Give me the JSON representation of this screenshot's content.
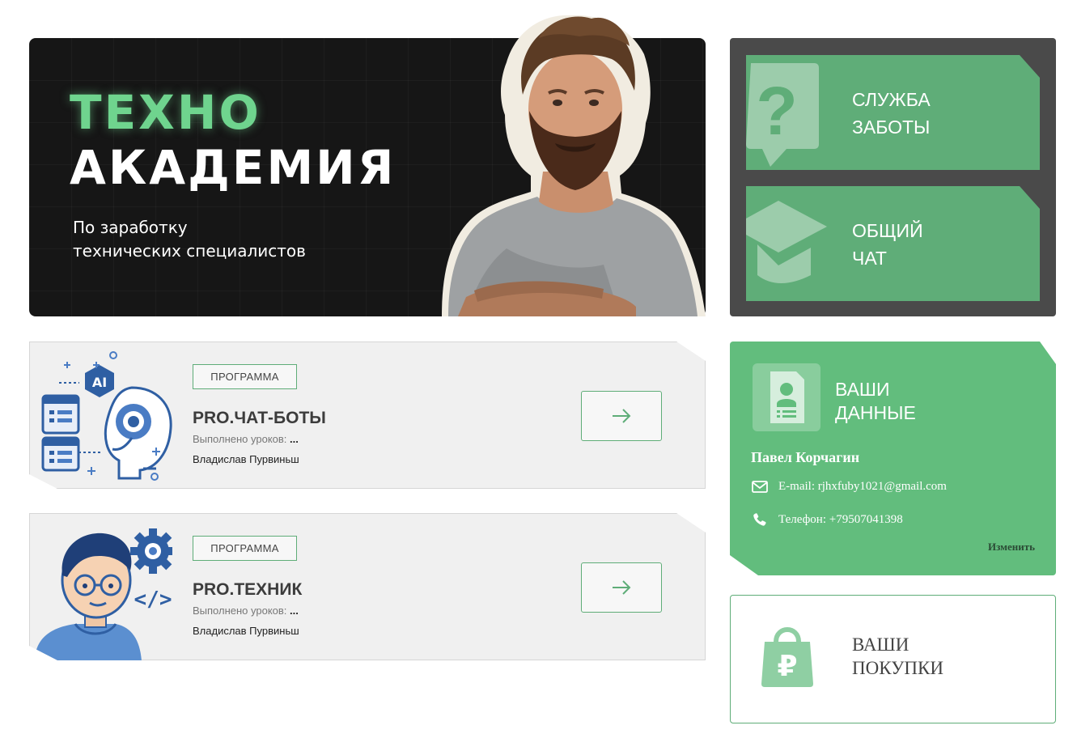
{
  "hero": {
    "title_line1": "ТЕХНО",
    "title_line2": "АКАДЕМИЯ",
    "subtitle_line1": "По заработку",
    "subtitle_line2": "технических специалистов"
  },
  "nav": {
    "support": {
      "label": "СЛУЖБА\nЗАБОТЫ",
      "icon": "question-bubble-icon"
    },
    "chat": {
      "label": "ОБЩИЙ\nЧАТ",
      "icon": "graduation-cap-icon"
    }
  },
  "programs": [
    {
      "tag": "ПРОГРАММА",
      "title": "PRO.ЧАТ-БОТЫ",
      "lessons_label": "Выполнено уроков:",
      "lessons_value": "...",
      "author": "Владислав Пурвиньш",
      "illustration": "ai-robot-illustration"
    },
    {
      "tag": "ПРОГРАММА",
      "title": "PRO.ТЕХНИК",
      "lessons_label": "Выполнено уроков:",
      "lessons_value": "...",
      "author": "Владислав Пурвиньш",
      "illustration": "developer-illustration"
    }
  ],
  "user": {
    "title": "ВАШИ\nДАННЫЕ",
    "name": "Павел Корчагин",
    "email": "E-mail: rjhxfuby1021@gmail.com",
    "phone": "Телефон: +79507041398",
    "edit_label": "Изменить"
  },
  "purchases": {
    "label": "ВАШИ\nПОКУПКИ",
    "icon": "ruble-bag-icon"
  },
  "colors": {
    "accent_green": "#62bd7d",
    "dark_panel": "#4a4a4a",
    "hero_bg": "#161616",
    "neon_green": "#6fd48e"
  }
}
